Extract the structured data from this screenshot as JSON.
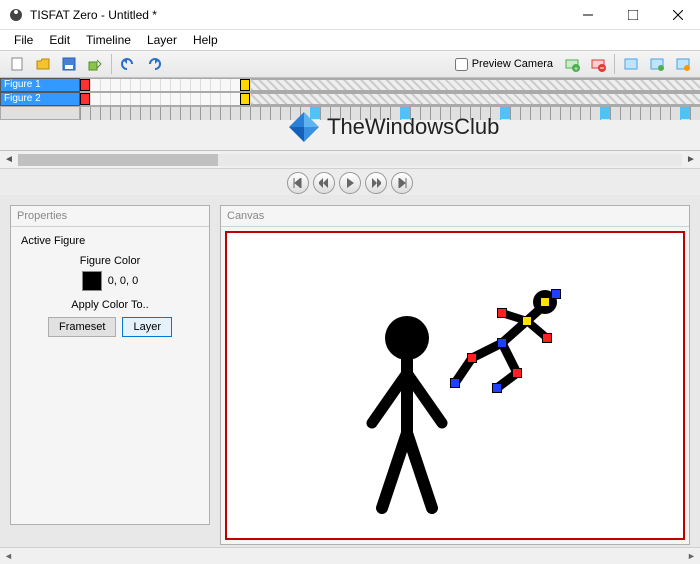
{
  "window": {
    "title": "TISFAT Zero - Untitled *"
  },
  "menu": {
    "file": "File",
    "edit": "Edit",
    "timeline": "Timeline",
    "layer": "Layer",
    "help": "Help"
  },
  "toolbar": {
    "preview_camera_label": "Preview Camera",
    "icons": {
      "new": "new-file",
      "open": "open-folder",
      "save": "save-disk",
      "export": "export",
      "undo": "undo",
      "redo": "redo",
      "addlayer": "add-layer",
      "removelayer": "remove-layer",
      "a1": "window-a",
      "a2": "window-b",
      "a3": "window-c"
    }
  },
  "timeline": {
    "figures": [
      "Figure 1",
      "Figure 2"
    ]
  },
  "watermark": {
    "text": "TheWindowsClub"
  },
  "playback": {
    "first": "first",
    "prev": "prev",
    "play": "play",
    "next": "next",
    "last": "last"
  },
  "properties": {
    "panel_title": "Properties",
    "active_figure_label": "Active Figure",
    "figure_color_label": "Figure Color",
    "color_value": "0, 0, 0",
    "apply_label": "Apply Color To..",
    "frameset_btn": "Frameset",
    "layer_btn": "Layer"
  },
  "canvas": {
    "panel_title": "Canvas"
  }
}
